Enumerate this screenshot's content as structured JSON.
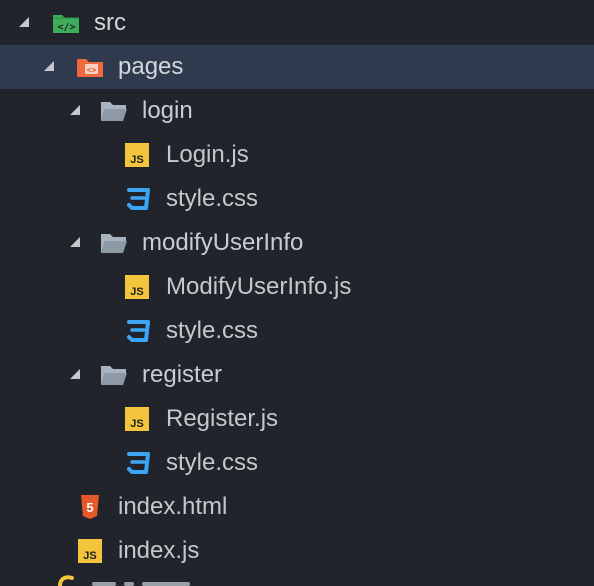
{
  "colors": {
    "background": "#21252b",
    "selected_row": "#2f3a4e",
    "text": "#c5c8cd",
    "js_badge": "#f2c53d",
    "css_icon": "#3ca6f6",
    "html_icon": "#e4582a",
    "folder": "#a9b3bf",
    "src_folder": "#3fae5a",
    "pages_folder": "#f0683e"
  },
  "tree": {
    "src": {
      "label": "src",
      "icon": "code-folder-icon"
    },
    "pages": {
      "label": "pages",
      "icon": "pages-folder-icon"
    },
    "login": {
      "label": "login",
      "icon": "folder-open-icon"
    },
    "login_js": {
      "label": "Login.js",
      "icon": "js-file-icon",
      "badge": "JS"
    },
    "login_css": {
      "label": "style.css",
      "icon": "css-file-icon"
    },
    "modify": {
      "label": "modifyUserInfo",
      "icon": "folder-open-icon"
    },
    "modify_js": {
      "label": "ModifyUserInfo.js",
      "icon": "js-file-icon",
      "badge": "JS"
    },
    "modify_css": {
      "label": "style.css",
      "icon": "css-file-icon"
    },
    "register": {
      "label": "register",
      "icon": "folder-open-icon"
    },
    "register_js": {
      "label": "Register.js",
      "icon": "js-file-icon",
      "badge": "JS"
    },
    "register_css": {
      "label": "style.css",
      "icon": "css-file-icon"
    },
    "index_html": {
      "label": "index.html",
      "icon": "html-file-icon",
      "badge": "5"
    },
    "index_js": {
      "label": "index.js",
      "icon": "js-file-icon",
      "badge": "JS"
    }
  }
}
